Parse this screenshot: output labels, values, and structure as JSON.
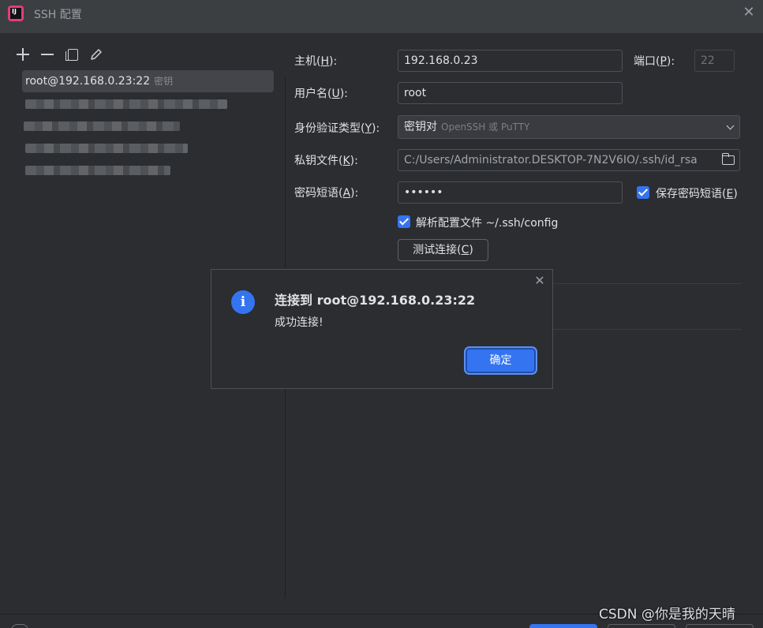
{
  "window": {
    "title": "SSH 配置"
  },
  "toolbar": {
    "add": "add",
    "remove": "remove",
    "copy": "copy",
    "edit": "edit"
  },
  "host_list": {
    "selected": {
      "label": "root@192.168.0.23:22",
      "tag": "密钥"
    },
    "obscured_count": 4
  },
  "form": {
    "host": {
      "label_pre": "主机(",
      "mnemonic": "H",
      "label_post": "):",
      "value": "192.168.0.23"
    },
    "port": {
      "label_pre": "端口(",
      "mnemonic": "P",
      "label_post": "):",
      "value": "22"
    },
    "username": {
      "label_pre": "用户名(",
      "mnemonic": "U",
      "label_post": "):",
      "value": "root"
    },
    "auth_type": {
      "label_pre": "身份验证类型(",
      "mnemonic": "Y",
      "label_post": "):",
      "value": "密钥对",
      "sub": "OpenSSH 或 PuTTY"
    },
    "key_file": {
      "label_pre": "私钥文件(",
      "mnemonic": "K",
      "label_post": "):",
      "value": "C:/Users/Administrator.DESKTOP-7N2V6IO/.ssh/id_rsa"
    },
    "passphrase": {
      "label_pre": "密码短语(",
      "mnemonic": "A",
      "label_post": "):",
      "value": "••••••"
    },
    "save_passphrase": {
      "label_pre": "保存密码短语(",
      "mnemonic": "E",
      "label_post": ")",
      "checked": true
    },
    "parse_config": {
      "label": "解析配置文件 ~/.ssh/config",
      "checked": true
    },
    "test_button": {
      "label_pre": "测试连接(",
      "mnemonic": "C",
      "label_post": ")"
    }
  },
  "dialog": {
    "title": "连接到 root@192.168.0.23:22",
    "message": "成功连接!",
    "ok": "确定"
  },
  "watermark": "CSDN @你是我的天晴"
}
